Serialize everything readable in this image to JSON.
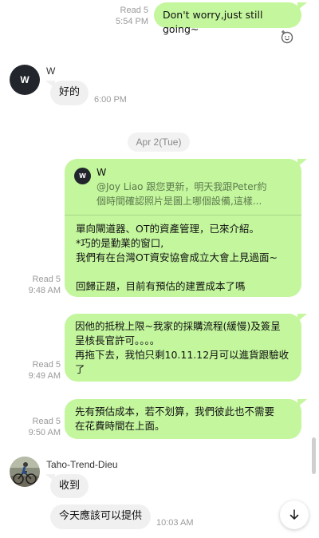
{
  "messages": [
    {
      "read": "Read 5",
      "time": "5:54 PM",
      "text": "Don't worry,just still going~"
    },
    {
      "sender": "W",
      "avatar": "W",
      "text": "好的",
      "time": "6:00 PM"
    },
    {
      "read": "Read 5",
      "time": "9:48 AM",
      "quote_sender": "W",
      "quote_avatar": "W",
      "quote_line1": "@Joy Liao  跟您更新，明天我跟Peter約",
      "quote_line2": "個時間確認照片是圖上哪個設備,這樣...",
      "line1": "單向閘道器、OT的資產管理，已來介紹。",
      "line2": "*巧的是勤業的窗口,",
      "line3": "我們有在台灣OT資安協會成立大會上見過面~",
      "line4": "回歸正題，目前有預估的建置成本了嗎"
    },
    {
      "read": "Read 5",
      "time": "9:49 AM",
      "line1": "因他的抵稅上限~我家的採購流程(緩慢)及簽呈",
      "line2": "呈核長官許可。。。。",
      "line3": "再拖下去，我怕只剩10.11.12月可以進貨跟驗收",
      "line4": "了"
    },
    {
      "read": "Read 5",
      "time": "9:50 AM",
      "line1": "先有預估成本，若不划算，我們彼此也不需要",
      "line2": "在花費時間在上面。"
    },
    {
      "sender": "Taho-Trend-Dieu",
      "text": "收到"
    },
    {
      "text": "今天應該可以提供",
      "time": "10:03 AM"
    }
  ],
  "date_divider": "Apr 2(Tue)",
  "colors": {
    "my_bubble": "#c3f69d",
    "their_bubble": "#f0f0f0",
    "meta_text": "#9a9a9a"
  },
  "icons": {
    "reaction": "add-reaction-icon",
    "scroll": "arrow-down-icon"
  }
}
